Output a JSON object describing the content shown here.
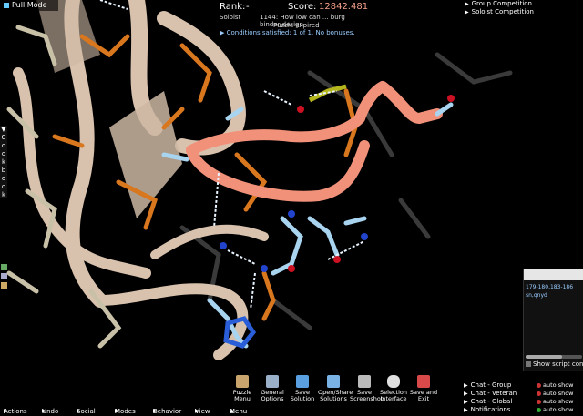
{
  "top": {
    "pull_mode": "Pull Mode"
  },
  "score_panel": {
    "rank_label": "Rank:",
    "rank_value": "-",
    "score_label": "Score:",
    "score_value": "12842.481",
    "role": "Soloist",
    "puzzle_title": "1144: How low can ... burg binder design",
    "status": "Puzzle expired",
    "conditions": "Conditions satisfied: 1 of 1. No bonuses."
  },
  "competition": {
    "items": [
      "Group Competition",
      "Soloist Competition"
    ]
  },
  "cookbook": {
    "label": "Cookbook"
  },
  "tools": [
    {
      "label": "Puzzle Menu",
      "icon": "puzzle-menu-icon",
      "color": "#c9a46c"
    },
    {
      "label": "General Options",
      "icon": "wrench-icon",
      "color": "#9ab0c8"
    },
    {
      "label": "Save Solution",
      "icon": "save-icon",
      "color": "#5aa0e0"
    },
    {
      "label": "Open/Share Solutions",
      "icon": "folder-icon",
      "color": "#7ab2e6"
    },
    {
      "label": "Save Screenshot",
      "icon": "camera-icon",
      "color": "#bbbbbb"
    },
    {
      "label": "Selection Interface",
      "icon": "mouse-icon",
      "color": "#e0e0e0"
    },
    {
      "label": "Save and Exit",
      "icon": "exit-icon",
      "color": "#d84a4a"
    }
  ],
  "menu_bar": {
    "items": [
      "Actions",
      "Undo",
      "Social",
      "Modes",
      "Behavior",
      "View",
      "Menu"
    ]
  },
  "selection": {
    "line1": "179-180,183-186",
    "line2": "sn,qnyd",
    "show_script": "Show script con"
  },
  "chat": {
    "rows": [
      "Chat - Group",
      "Chat - Veteran",
      "Chat - Global",
      "Notifications"
    ],
    "auto_show": "auto show"
  },
  "colors": {
    "backbone": "#d9c2ad",
    "loop": "#f2917a",
    "sidechain_orange": "#d8771e",
    "carbon_blue": "#a8d4f0",
    "nitrogen": "#2244cc",
    "oxygen": "#cc1122"
  }
}
